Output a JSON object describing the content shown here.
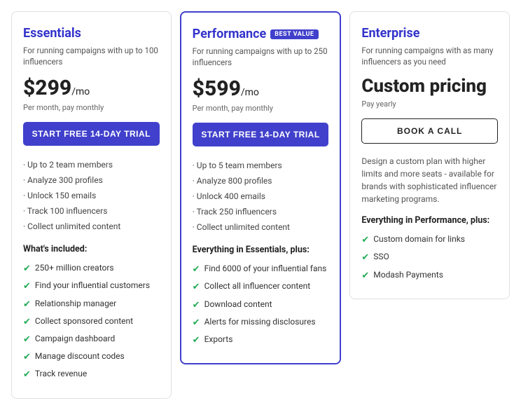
{
  "plans": [
    {
      "id": "essentials",
      "title": "Essentials",
      "subtitle": "For running campaigns with up to 100 influencers",
      "price": "$299",
      "period": "/mo",
      "billing": "Per month, pay monthly",
      "cta": "START FREE 14-DAY TRIAL",
      "cta_style": "filled",
      "highlighted": false,
      "badge": null,
      "bullet_features": [
        "Up to 2 team members",
        "Analyze 300 profiles",
        "Unlock 150 emails",
        "Track 100 influencers",
        "Collect unlimited content"
      ],
      "section_label": "What's included:",
      "check_features": [
        "250+ million creators",
        "Find your influential customers",
        "Relationship manager",
        "Collect sponsored content",
        "Campaign dashboard",
        "Manage discount codes",
        "Track revenue"
      ],
      "custom_pricing": null,
      "pay_yearly": null,
      "enterprise_desc": null
    },
    {
      "id": "performance",
      "title": "Performance",
      "subtitle": "For running campaigns with up to 250 influencers",
      "price": "$599",
      "period": "/mo",
      "billing": "Per month, pay monthly",
      "cta": "START FREE 14-DAY TRIAL",
      "cta_style": "filled",
      "highlighted": true,
      "badge": "BEST VALUE",
      "bullet_features": [
        "Up to 5 team members",
        "Analyze 800 profiles",
        "Unlock 400 emails",
        "Track 250 influencers",
        "Collect unlimited content"
      ],
      "section_label": "Everything in Essentials, plus:",
      "check_features": [
        "Find 6000 of your influential fans",
        "Collect all influencer content",
        "Download content",
        "Alerts for missing disclosures",
        "Exports"
      ],
      "custom_pricing": null,
      "pay_yearly": null,
      "enterprise_desc": null
    },
    {
      "id": "enterprise",
      "title": "Enterprise",
      "subtitle": "For running campaigns with as many influencers as you need",
      "price": null,
      "period": null,
      "billing": null,
      "cta": "BOOK A CALL",
      "cta_style": "outline",
      "highlighted": false,
      "badge": null,
      "bullet_features": [],
      "section_label": "Everything in Performance, plus:",
      "check_features": [
        "Custom domain for links",
        "SSO",
        "Modash Payments"
      ],
      "custom_pricing": "Custom pricing",
      "pay_yearly": "Pay yearly",
      "enterprise_desc": "Design a custom plan with higher limits and more seats - available for brands with sophisticated influencer marketing programs."
    }
  ]
}
